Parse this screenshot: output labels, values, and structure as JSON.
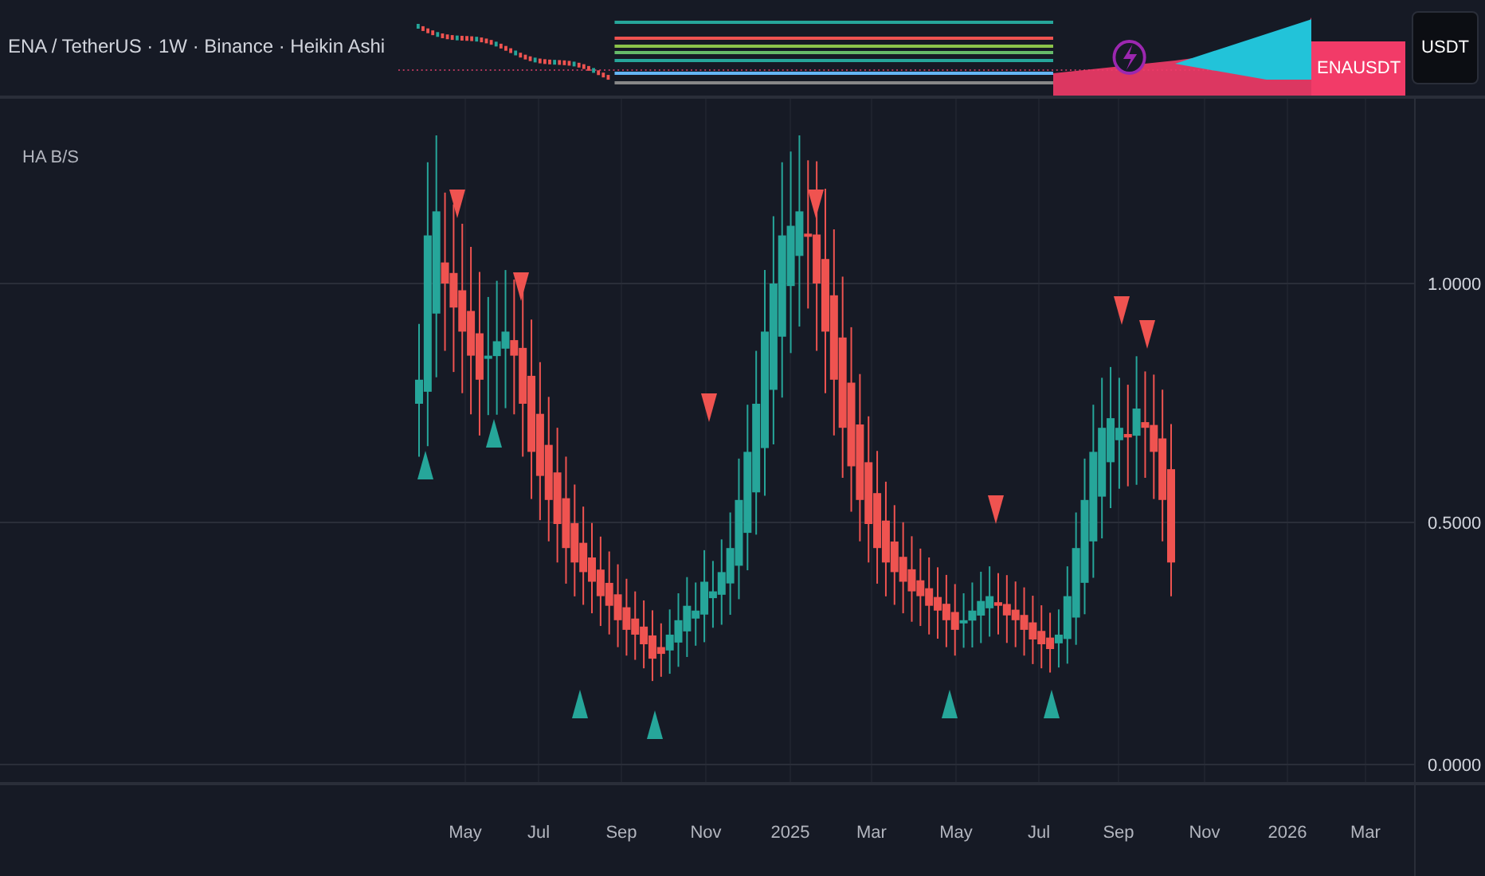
{
  "header": {
    "title": "ENA / TetherUS · 1W · Binance · Heikin Ashi",
    "symbol_badge": "ENAUSDT",
    "currency_badge": "USDT"
  },
  "indicator": {
    "label": "HA B/S"
  },
  "price_axis": {
    "labels": [
      "1.0000",
      "0.5000",
      "0.0000"
    ]
  },
  "time_axis": {
    "labels": [
      "May",
      "Jul",
      "Sep",
      "Nov",
      "2025",
      "Mar",
      "May",
      "Jul",
      "Sep",
      "Nov",
      "2026",
      "Mar"
    ]
  }
}
